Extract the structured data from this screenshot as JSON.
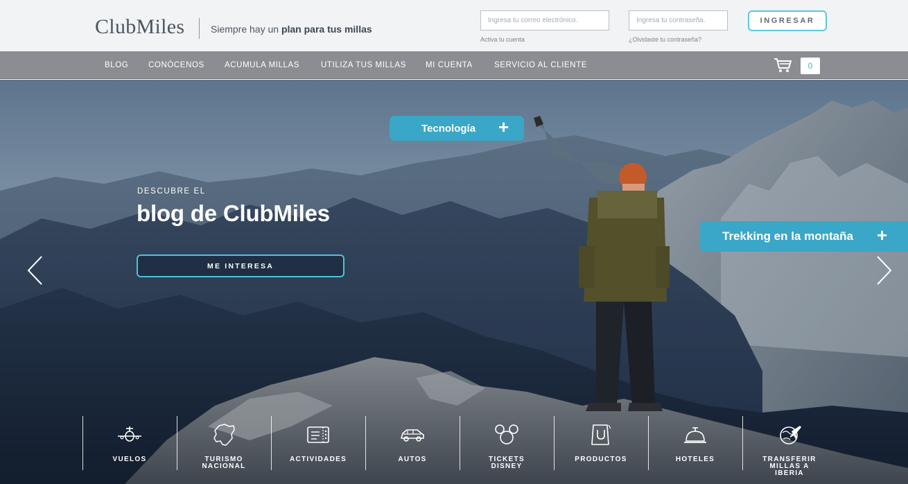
{
  "header": {
    "logo": "ClubMiles",
    "tagline_prefix": "Siempre hay un ",
    "tagline_bold": "plan para tus millas",
    "email_placeholder": "Ingresa tu correo electrónico.",
    "password_placeholder": "Ingresa tu contraseña.",
    "activate_link": "Activa tu cuenta",
    "forgot_link": "¿Olvidaste tu contraseña?",
    "login_button": "INGRESAR"
  },
  "nav": {
    "items": [
      "BLOG",
      "CONÓCENOS",
      "ACUMULA MILLAS",
      "UTILIZA TUS MILLAS",
      "MI CUENTA",
      "SERVICIO AL CLIENTE"
    ],
    "cart_icon": "shopping-cart-icon",
    "cart_count": "0"
  },
  "hero": {
    "kicker": "DESCUBRE EL",
    "title": "blog de ClubMiles",
    "cta": "ME INTERESA",
    "hotspots": [
      "Tecnología",
      "Trekking en la montaña"
    ],
    "hotspot_icon": "plus-icon",
    "prev_icon": "chevron-left-icon",
    "next_icon": "chevron-right-icon"
  },
  "categories": [
    {
      "label": "VUELOS",
      "icon": "airplane-icon"
    },
    {
      "label": "TURISMO NACIONAL",
      "icon": "ecuador-map-icon"
    },
    {
      "label": "ACTIVIDADES",
      "icon": "ticket-icon"
    },
    {
      "label": "AUTOS",
      "icon": "car-icon"
    },
    {
      "label": "TICKETS DISNEY",
      "icon": "mickey-ears-icon"
    },
    {
      "label": "PRODUCTOS",
      "icon": "shopping-bag-icon"
    },
    {
      "label": "HOTELES",
      "icon": "service-bell-icon"
    },
    {
      "label": "TRANSFERIR MILLAS A IBERIA",
      "icon": "globe-plane-icon"
    }
  ],
  "colors": {
    "accent": "#4cc4dc",
    "hotspot": "#3aa6c8",
    "nav_background": "#8b8d92",
    "header_background": "#f2f3f5",
    "text_dark": "#4b5661"
  }
}
